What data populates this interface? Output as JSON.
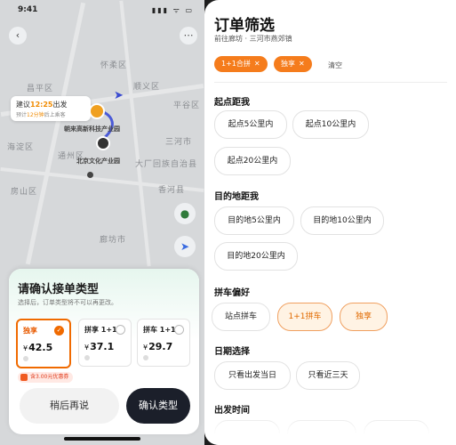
{
  "status": {
    "time": "9:41",
    "icons": "▮▮▮ ᯤ ▭"
  },
  "map": {
    "labels": [
      "怀柔区",
      "昌平区",
      "顺义区",
      "平谷区",
      "海淀区",
      "通州区",
      "三河市",
      "大厂回族自治县",
      "香河县",
      "房山区",
      "廊坊市"
    ],
    "bubble": {
      "prefix": "建议",
      "time": "12:25",
      "suffix": "出发",
      "sub_prefix": "预计",
      "sub_time": "12分钟",
      "sub_suffix": "后上乘客"
    },
    "poi_a": "朝来高新科技产业园",
    "poi_b": "北京文化产业园"
  },
  "sheet": {
    "title": "请确认接单类型",
    "subtitle": "选择后，订单类型将不可以再更改。",
    "cards": [
      {
        "name": "独享",
        "price": "42.5",
        "selected": true
      },
      {
        "name": "拼享 1+1",
        "price": "37.1",
        "selected": false
      },
      {
        "name": "拼车 1+1",
        "price": "29.7",
        "selected": false
      }
    ],
    "currency": "¥",
    "check": "✓",
    "coupon": "含3.00元优惠券",
    "later_label": "稍后再说",
    "confirm_label": "确认类型"
  },
  "filter": {
    "title": "订单筛选",
    "destination": "前往廊坊 · 三河市燕郊镇",
    "active_tags": [
      "1+1合拼",
      "独享"
    ],
    "tag_close": "✕",
    "clear_label": "清空",
    "sections": [
      {
        "title": "起点距我",
        "options": [
          "起点5公里内",
          "起点10公里内",
          "起点20公里内"
        ]
      },
      {
        "title": "目的地距我",
        "options": [
          "目的地5公里内",
          "目的地10公里内",
          "目的地20公里内"
        ]
      },
      {
        "title": "拼车偏好",
        "options": [
          "站点拼车",
          "1+1拼车",
          "独享"
        ]
      },
      {
        "title": "日期选择",
        "options": [
          "只看出发当日",
          "只看近三天"
        ]
      },
      {
        "title": "出发时间",
        "options": []
      }
    ]
  },
  "colors": {
    "accent": "#f57c1c",
    "dark_button": "#1b1f2a"
  }
}
